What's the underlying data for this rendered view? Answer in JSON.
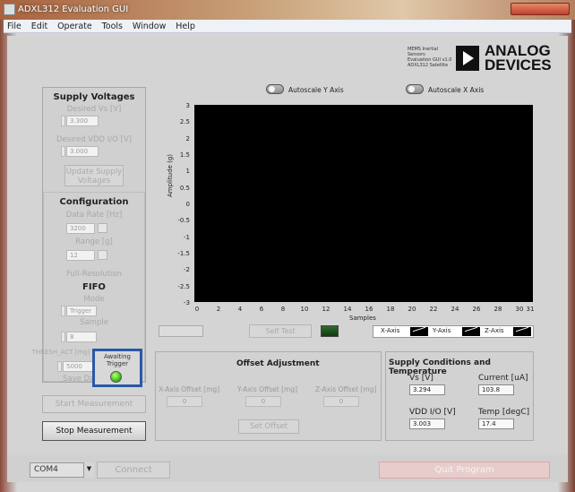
{
  "window": {
    "title": "ADXL312 Evaluation GUI"
  },
  "menu": [
    "File",
    "Edit",
    "Operate",
    "Tools",
    "Window",
    "Help"
  ],
  "branding": {
    "tagline": [
      "MEMS Inertial Sensors",
      "Evaluation GUI v1.0",
      "ADXL312 Satellite"
    ],
    "name_line1": "ANALOG",
    "name_line2": "DEVICES"
  },
  "supply": {
    "title": "Supply Voltages",
    "vs_label": "Desired Vs [V]",
    "vs_value": "3.300",
    "vdd_label": "Desired VDD I/O [V]",
    "vdd_value": "3.000",
    "update_button": "Update Supply Voltages"
  },
  "config": {
    "title": "Configuration",
    "rate_label": "Data Rate [Hz]",
    "rate_value": "3200",
    "range_label": "Range [g]",
    "range_value": "12",
    "fullres_label": "Full-Resolution",
    "fifo_title": "FIFO",
    "mode_label": "Mode",
    "mode_value": "Trigger",
    "sample_label": "Sample",
    "sample_value": "8",
    "thresh_label": "THRESH_ACT [mg]",
    "thresh_value": "5000",
    "save_label": "Save Data"
  },
  "trigger": {
    "status": "Awaiting Trigger",
    "led_color": "#3ac21a"
  },
  "buttons": {
    "start": "Start Measurement",
    "stop": "Stop Measurement",
    "self_test": "Self Test",
    "set_offset": "Set Offset",
    "connect": "Connect",
    "quit": "Quit Program"
  },
  "plot": {
    "autoscale_y": "Autoscale Y Axis",
    "autoscale_x": "Autoscale X Axis",
    "ylabel": "Amplitude (g)",
    "xlabel": "Samples",
    "yticks": [
      "3",
      "2.5",
      "2",
      "1.5",
      "1",
      "0.5",
      "0",
      "-0.5",
      "-1",
      "-1.5",
      "-2",
      "-2.5",
      "-3"
    ],
    "xticks": [
      "0",
      "2",
      "4",
      "6",
      "8",
      "10",
      "12",
      "14",
      "16",
      "18",
      "20",
      "22",
      "24",
      "26",
      "28",
      "30",
      "31"
    ],
    "legend": [
      "X-Axis",
      "Y-Axis",
      "Z-Axis"
    ]
  },
  "offset": {
    "title": "Offset Adjustment",
    "x_label": "X-Axis Offset [mg]",
    "y_label": "Y-Axis Offset [mg]",
    "z_label": "Z-Axis Offset [mg]",
    "x_value": "0",
    "y_value": "0",
    "z_value": "0"
  },
  "conditions": {
    "title": "Supply Conditions and Temperature",
    "vs_label": "Vs [V]",
    "vs_value": "3.294",
    "current_label": "Current [uA]",
    "current_value": "103.8",
    "vdd_label": "VDD I/O [V]",
    "vdd_value": "3.003",
    "temp_label": "Temp [degC]",
    "temp_value": "17.4"
  },
  "port": {
    "value": "COM4"
  }
}
